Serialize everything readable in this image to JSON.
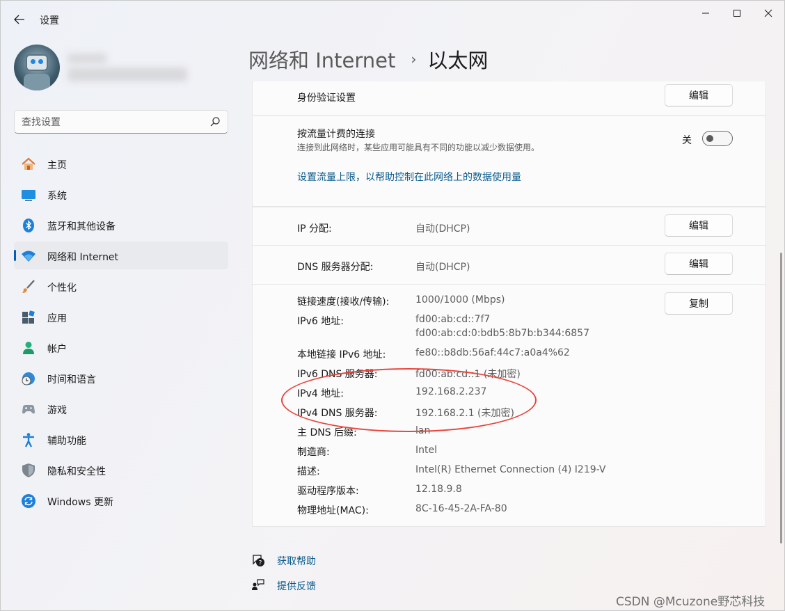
{
  "window": {
    "app_title": "设置"
  },
  "search": {
    "placeholder": "查找设置"
  },
  "sidebar": {
    "items": [
      {
        "label": "主页",
        "icon": "home-icon"
      },
      {
        "label": "系统",
        "icon": "system-icon"
      },
      {
        "label": "蓝牙和其他设备",
        "icon": "bluetooth-icon"
      },
      {
        "label": "网络和 Internet",
        "icon": "wifi-icon",
        "active": true
      },
      {
        "label": "个性化",
        "icon": "brush-icon"
      },
      {
        "label": "应用",
        "icon": "apps-icon"
      },
      {
        "label": "帐户",
        "icon": "account-icon"
      },
      {
        "label": "时间和语言",
        "icon": "globe-clock-icon"
      },
      {
        "label": "游戏",
        "icon": "gamepad-icon"
      },
      {
        "label": "辅助功能",
        "icon": "accessibility-icon"
      },
      {
        "label": "隐私和安全性",
        "icon": "shield-icon"
      },
      {
        "label": "Windows 更新",
        "icon": "update-icon"
      }
    ]
  },
  "header": {
    "parent": "网络和 Internet",
    "separator": "›",
    "current": "以太网"
  },
  "auth": {
    "label": "身份验证设置",
    "button": "编辑"
  },
  "metered": {
    "label": "按流量计费的连接",
    "description": "连接到此网络时，某些应用可能具有不同的功能以减少数据使用。",
    "toggle_state": "关",
    "toggle_on": false,
    "link": "设置流量上限，以帮助控制在此网络上的数据使用量"
  },
  "ip_assignment": {
    "label": "IP 分配:",
    "value": "自动(DHCP)",
    "button": "编辑"
  },
  "dns_assignment": {
    "label": "DNS 服务器分配:",
    "value": "自动(DHCP)",
    "button": "编辑"
  },
  "properties": {
    "copy_button": "复制",
    "rows": [
      {
        "label": "链接速度(接收/传输):",
        "value": "1000/1000 (Mbps)"
      },
      {
        "label": "IPv6 地址:",
        "value": "fd00:ab:cd::7f7",
        "value2": "fd00:ab:cd:0:bdb5:8b7b:b344:6857"
      },
      {
        "label": "本地链接 IPv6 地址:",
        "value": "fe80::b8db:56af:44c7:a0a4%62"
      },
      {
        "label": "IPv6 DNS 服务器:",
        "value": "fd00:ab:cd::1 (未加密)"
      },
      {
        "label": "IPv4 地址:",
        "value": "192.168.2.237"
      },
      {
        "label": "IPv4 DNS 服务器:",
        "value": "192.168.2.1 (未加密)"
      },
      {
        "label": "主 DNS 后缀:",
        "value": "lan"
      },
      {
        "label": "制造商:",
        "value": "Intel"
      },
      {
        "label": "描述:",
        "value": "Intel(R) Ethernet Connection (4) I219-V"
      },
      {
        "label": "驱动程序版本:",
        "value": "12.18.9.8"
      },
      {
        "label": "物理地址(MAC):",
        "value": "8C-16-45-2A-FA-80"
      }
    ]
  },
  "footer": {
    "help": "获取帮助",
    "feedback": "提供反馈"
  },
  "watermark": "CSDN @Mcuzone野芯科技",
  "colors": {
    "accent": "#005fb8",
    "link": "#0a5a8c",
    "annotation": "#e8453c"
  }
}
